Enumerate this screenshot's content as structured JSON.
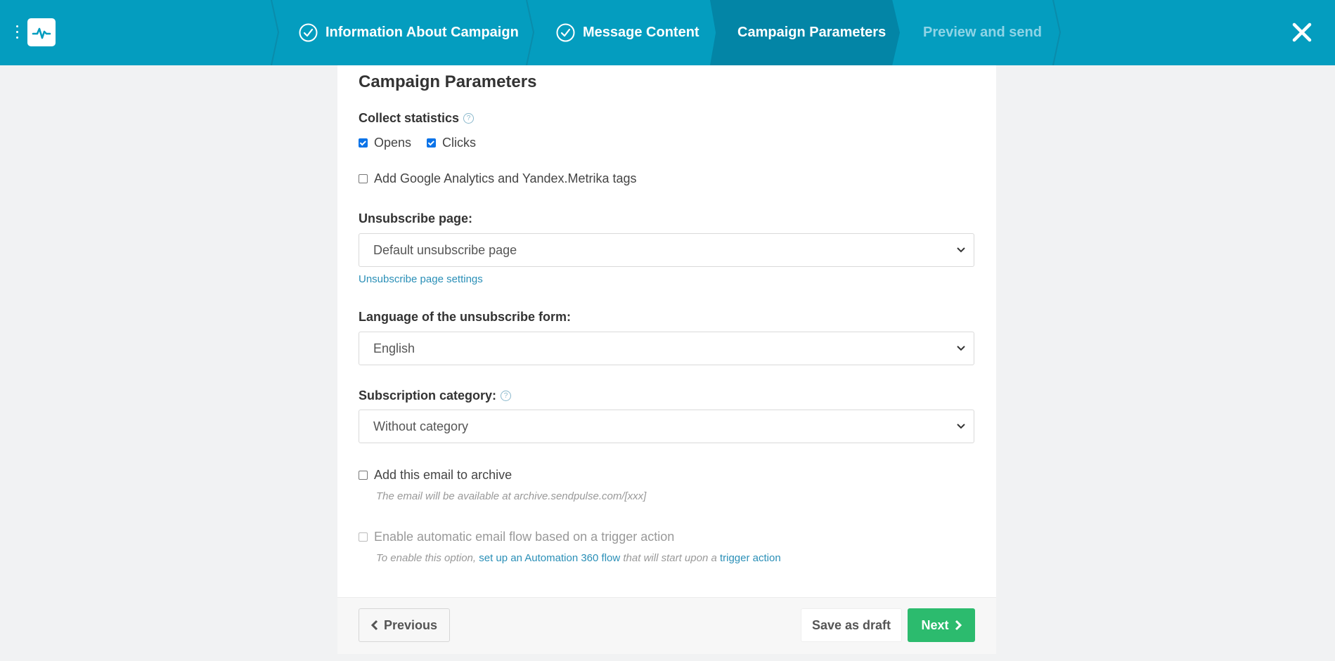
{
  "colors": {
    "header": "#049dbf",
    "header_active": "#0385a6",
    "accent_link": "#2a8fb7",
    "next_button": "#2cbb6e",
    "checkbox_checked": "#0b73e8"
  },
  "header": {
    "menu_icon": "vertical-dots-icon",
    "logo_icon": "pulse-logo-icon",
    "steps": [
      {
        "label": "Information About Campaign",
        "state": "completed",
        "icon": "check-circle-icon"
      },
      {
        "label": "Message Content",
        "state": "completed",
        "icon": "check-circle-icon"
      },
      {
        "label": "Campaign Parameters",
        "state": "active"
      },
      {
        "label": "Preview and send",
        "state": "upcoming"
      }
    ],
    "close_icon": "close-icon"
  },
  "form": {
    "title": "Campaign Parameters",
    "collect_statistics": {
      "label": "Collect statistics",
      "opens": {
        "label": "Opens",
        "checked": true
      },
      "clicks": {
        "label": "Clicks",
        "checked": true
      }
    },
    "analytics_tags": {
      "label": "Add Google Analytics and Yandex.Metrika tags",
      "checked": false
    },
    "unsubscribe_page": {
      "label": "Unsubscribe page:",
      "value": "Default unsubscribe page",
      "settings_link": "Unsubscribe page settings"
    },
    "unsubscribe_language": {
      "label": "Language of the unsubscribe form:",
      "value": "English"
    },
    "subscription_category": {
      "label": "Subscription category:",
      "value": "Without category"
    },
    "archive": {
      "label": "Add this email to archive",
      "checked": false,
      "hint": "The email will be available at archive.sendpulse.com/[xxx]"
    },
    "automation": {
      "label": "Enable automatic email flow based on a trigger action",
      "checked": false,
      "disabled": true,
      "hint_prefix": "To enable this option,",
      "hint_link1": "set up an Automation 360 flow",
      "hint_middle": "that will start upon a",
      "hint_link2": "trigger action"
    }
  },
  "footer": {
    "previous_label": "Previous",
    "draft_label": "Save as draft",
    "next_label": "Next"
  }
}
